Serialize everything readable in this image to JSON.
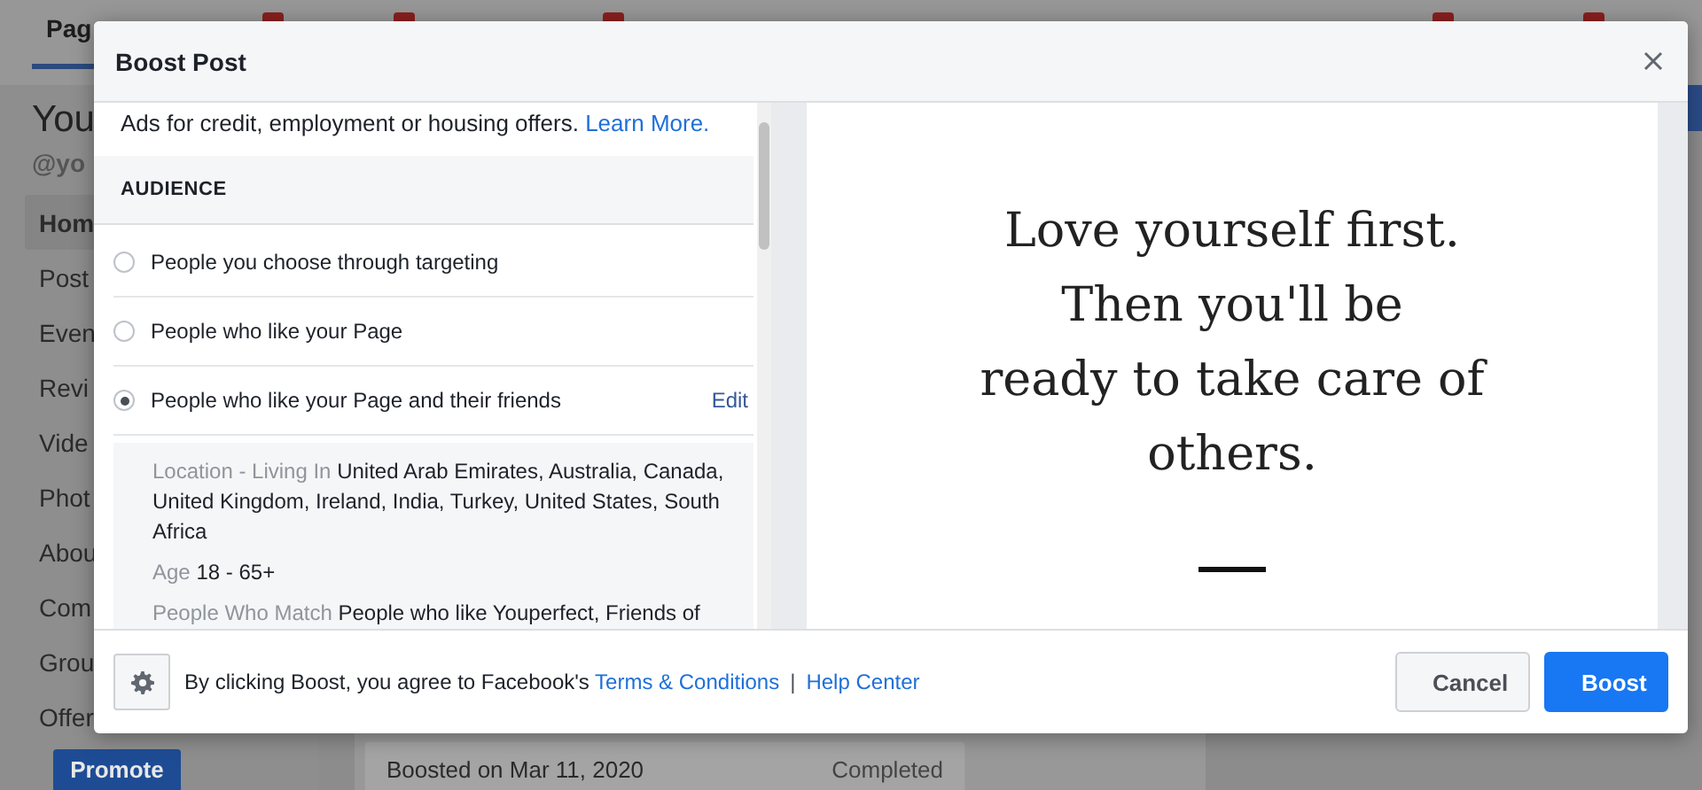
{
  "background_page": {
    "tab": "Pag",
    "page_title": "You",
    "page_handle": "@yo",
    "nav": [
      {
        "label": "Hom",
        "selected": true
      },
      {
        "label": "Post",
        "selected": false
      },
      {
        "label": "Even",
        "selected": false
      },
      {
        "label": "Revi",
        "selected": false
      },
      {
        "label": "Vide",
        "selected": false
      },
      {
        "label": "Phot",
        "selected": false
      },
      {
        "label": "Abou",
        "selected": false
      },
      {
        "label": "Com",
        "selected": false
      },
      {
        "label": "Grou",
        "selected": false
      },
      {
        "label": "Offer",
        "selected": false
      }
    ],
    "promote_button": "Promote",
    "boost_card": {
      "title": "Boosted on Mar 11, 2020",
      "status": "Completed"
    }
  },
  "dialog": {
    "title": "Boost Post",
    "notice": {
      "text": "Ads for credit, employment or housing offers.",
      "link": "Learn More."
    },
    "section_title": "AUDIENCE",
    "audience_options": [
      {
        "label": "People you choose through targeting",
        "selected": false
      },
      {
        "label": "People who like your Page",
        "selected": false
      },
      {
        "label": "People who like your Page and their friends",
        "selected": true,
        "action": "Edit"
      }
    ],
    "audience_details": [
      {
        "label": "Location - Living In",
        "value": "United Arab Emirates, Australia, Canada, United Kingdom, Ireland, India, Turkey, United States, South Africa"
      },
      {
        "label": "Age",
        "value": "18 - 65+"
      },
      {
        "label": "People Who Match",
        "value": "People who like Youperfect, Friends of"
      }
    ],
    "preview": {
      "quote_lines": [
        "Love yourself first.",
        "Then you'll be",
        "ready to take care of",
        "others."
      ]
    },
    "footer": {
      "agreement": "By clicking Boost, you agree to Facebook's",
      "terms_link": "Terms & Conditions",
      "separator": "|",
      "help_link": "Help Center"
    },
    "buttons": [
      {
        "label": "Cancel",
        "kind": "secondary"
      },
      {
        "label": "Boost",
        "kind": "primary"
      }
    ]
  }
}
